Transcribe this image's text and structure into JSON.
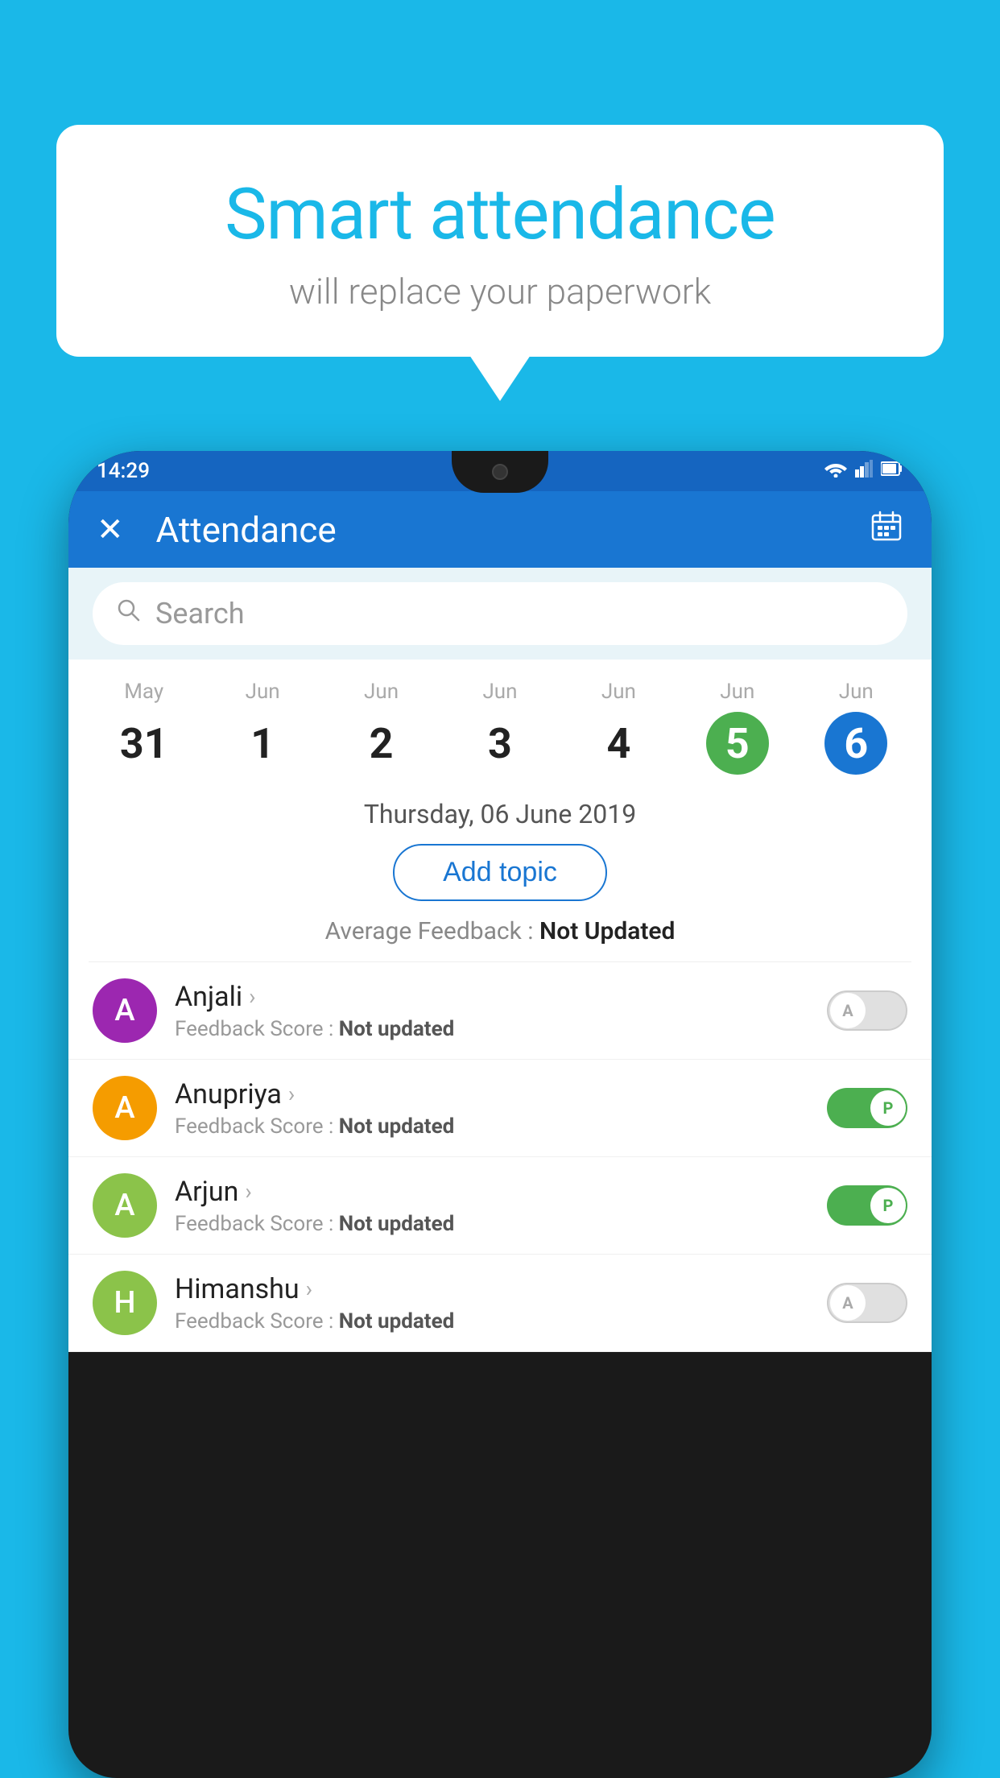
{
  "background_color": "#1ab8e8",
  "speech_bubble": {
    "title": "Smart attendance",
    "subtitle": "will replace your paperwork"
  },
  "status_bar": {
    "time": "14:29",
    "wifi_icon": "▼",
    "signal_icon": "▲",
    "battery_icon": "▮"
  },
  "app_header": {
    "close_label": "✕",
    "title": "Attendance",
    "calendar_icon": "📅"
  },
  "search": {
    "placeholder": "Search"
  },
  "calendar": {
    "days": [
      {
        "month": "May",
        "date": "31",
        "state": "normal"
      },
      {
        "month": "Jun",
        "date": "1",
        "state": "normal"
      },
      {
        "month": "Jun",
        "date": "2",
        "state": "normal"
      },
      {
        "month": "Jun",
        "date": "3",
        "state": "normal"
      },
      {
        "month": "Jun",
        "date": "4",
        "state": "normal"
      },
      {
        "month": "Jun",
        "date": "5",
        "state": "today"
      },
      {
        "month": "Jun",
        "date": "6",
        "state": "selected"
      }
    ]
  },
  "selected_date_label": "Thursday, 06 June 2019",
  "add_topic_label": "Add topic",
  "feedback_summary": {
    "label": "Average Feedback :",
    "value": "Not Updated"
  },
  "students": [
    {
      "name": "Anjali",
      "avatar_letter": "A",
      "avatar_color": "#9c27b0",
      "feedback_label": "Feedback Score :",
      "feedback_value": "Not updated",
      "toggle_state": "off",
      "toggle_label": "A"
    },
    {
      "name": "Anupriya",
      "avatar_letter": "A",
      "avatar_color": "#f59c00",
      "feedback_label": "Feedback Score :",
      "feedback_value": "Not updated",
      "toggle_state": "on",
      "toggle_label": "P"
    },
    {
      "name": "Arjun",
      "avatar_letter": "A",
      "avatar_color": "#8bc34a",
      "feedback_label": "Feedback Score :",
      "feedback_value": "Not updated",
      "toggle_state": "on",
      "toggle_label": "P"
    },
    {
      "name": "Himanshu",
      "avatar_letter": "H",
      "avatar_color": "#8bc34a",
      "feedback_label": "Feedback Score :",
      "feedback_value": "Not updated",
      "toggle_state": "off",
      "toggle_label": "A"
    }
  ]
}
